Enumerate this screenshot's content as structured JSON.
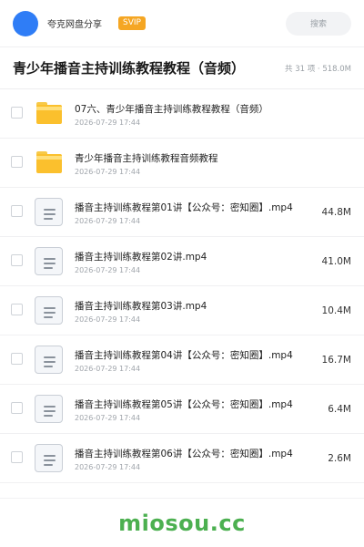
{
  "header": {
    "brand": "夸克网盘分享",
    "badge": "SVIP",
    "search_placeholder": "搜索"
  },
  "titlebar": {
    "title": "青少年播音主持训练教程教程（音频）",
    "summary": "共 31 项 · 518.0M"
  },
  "items": [
    {
      "type": "folder",
      "name": "07六、青少年播音主持训练教程教程（音频）",
      "date": "2026-07-29 17:44",
      "size": ""
    },
    {
      "type": "folder",
      "name": "青少年播音主持训练教程音频教程",
      "date": "2026-07-29 17:44",
      "size": ""
    },
    {
      "type": "file",
      "name": "播音主持训练教程第01讲【公众号：密知圈】.mp4",
      "date": "2026-07-29 17:44",
      "size": "44.8M"
    },
    {
      "type": "file",
      "name": "播音主持训练教程第02讲.mp4",
      "date": "2026-07-29 17:44",
      "size": "41.0M"
    },
    {
      "type": "file",
      "name": "播音主持训练教程第03讲.mp4",
      "date": "2026-07-29 17:44",
      "size": "10.4M"
    },
    {
      "type": "file",
      "name": "播音主持训练教程第04讲【公众号：密知圈】.mp4",
      "date": "2026-07-29 17:44",
      "size": "16.7M"
    },
    {
      "type": "file",
      "name": "播音主持训练教程第05讲【公众号：密知圈】.mp4",
      "date": "2026-07-29 17:44",
      "size": "6.4M"
    },
    {
      "type": "file",
      "name": "播音主持训练教程第06讲【公众号：密知圈】.mp4",
      "date": "2026-07-29 17:44",
      "size": "2.6M"
    }
  ],
  "footer": {
    "watermark": "miosou.cc"
  },
  "colors": {
    "accent": "#2f7df6",
    "badge": "#f5a623",
    "folder": "#fbc02d",
    "watermark": "#4cb050"
  }
}
